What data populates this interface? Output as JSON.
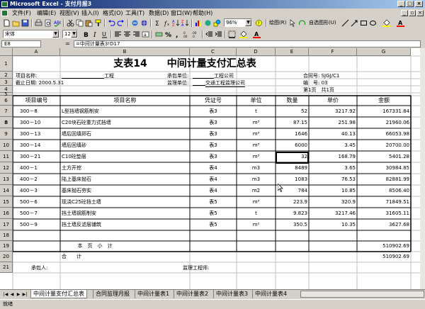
{
  "window": {
    "title": "Microsoft Excel - 支付月报3",
    "min": "_",
    "max": "□",
    "close": "×"
  },
  "menu": {
    "items": [
      "文件(F)",
      "编辑(E)",
      "视图(V)",
      "插入(I)",
      "格式(O)",
      "工具(T)",
      "数据(D)",
      "窗口(W)",
      "帮助(H)"
    ]
  },
  "toolbar": {
    "zoom": "96%",
    "draw_label": "绘图(R)",
    "autoshape_label": "自选图形(U)",
    "font": "宋体",
    "size": "12"
  },
  "formula_bar": {
    "name_box": "E8",
    "eq": "=",
    "formula": "=中间计量表3!D17"
  },
  "columns": [
    "A",
    "B",
    "C",
    "D",
    "E",
    "F",
    "G"
  ],
  "rows": [
    "1",
    "2",
    "3",
    "4",
    "5",
    "6",
    "7",
    "8",
    "9",
    "10",
    "11",
    "12",
    "13",
    "14",
    "15",
    "16",
    "17",
    "18",
    "19",
    "20",
    "21"
  ],
  "sheet": {
    "title": "支表14　　中间计量支付汇总表",
    "project_name_label": "项目名称:",
    "project_name_suffix": "工程",
    "contractor_label": "承包单位:",
    "contractor_value": "工程公司",
    "contract_no": "合同号: SJGJ/C1",
    "deadline": "截止日期: 2000.5.31",
    "supervisor_label": "监理单位:",
    "supervisor_value": "交通工程监理公司",
    "serial": "编　号: 03",
    "page": "第1页　共1页",
    "headers": [
      "项目编号",
      "项目名称",
      "凭证号",
      "单位",
      "数量",
      "单价",
      "金额"
    ],
    "items": [
      {
        "code": "300－8",
        "name": "L型挡墙钢筋制安",
        "voucher": "表3",
        "unit": "t",
        "qty": "52",
        "price": "3217.92",
        "amount": "167331.84"
      },
      {
        "code": "300－10",
        "name": "C20块石砼重力式挡墙",
        "voucher": "表3",
        "unit": "m³",
        "qty": "87.15",
        "price": "251.98",
        "amount": "21960.06"
      },
      {
        "code": "300－13",
        "name": "墙后回填卵石",
        "voucher": "表3",
        "unit": "m³",
        "qty": "1646",
        "price": "40.13",
        "amount": "66053.98"
      },
      {
        "code": "300－14",
        "name": "墙后回填砂",
        "voucher": "表3",
        "unit": "m³",
        "qty": "6000",
        "price": "3.45",
        "amount": "20700.00"
      },
      {
        "code": "300－21",
        "name": "C10砼垫层",
        "voucher": "表3",
        "unit": "m³",
        "qty": "32",
        "price": "168.79",
        "amount": "5401.28"
      },
      {
        "code": "400－1",
        "name": "土方开挖",
        "voucher": "表4",
        "unit": "m3",
        "qty": "8489",
        "price": "3.65",
        "amount": "30984.85"
      },
      {
        "code": "400－2",
        "name": "陆上基床抛石",
        "voucher": "表4",
        "unit": "m3",
        "qty": "1083",
        "price": "76.53",
        "amount": "82881.99"
      },
      {
        "code": "400－3",
        "name": "基床抛石夯实",
        "voucher": "表4",
        "unit": "m2",
        "qty": "784",
        "price": "10.85",
        "amount": "8506.40"
      },
      {
        "code": "500－6",
        "name": "现浇C25砼挡土墙",
        "voucher": "表5",
        "unit": "m³",
        "qty": "223.9",
        "price": "320.9",
        "amount": "71849.51"
      },
      {
        "code": "500－7",
        "name": "挡土墙钢筋制安",
        "voucher": "表5",
        "unit": "t",
        "qty": "9.823",
        "price": "3217.46",
        "amount": "31605.11"
      },
      {
        "code": "500－9",
        "name": "挡土墙反滤层铺筑",
        "voucher": "表5",
        "unit": "m²",
        "qty": "350.5",
        "price": "10.35",
        "amount": "3627.68"
      }
    ],
    "subtotal_label": "本　页　小　计",
    "subtotal_value": "510902.69",
    "total_label": "合　　计",
    "total_value": "510902.69",
    "contractor_sign": "承包人:",
    "engineer_sign": "监理工程师:"
  },
  "sheet_tabs": [
    "中间计量支付汇总表",
    "合同监理月报",
    "中间计量表1",
    "中间计量表2",
    "中间计量表3",
    "中间计量表4"
  ],
  "status": "就绪"
}
